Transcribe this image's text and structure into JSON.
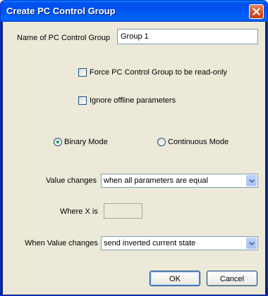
{
  "window": {
    "title": "Create PC Control Group"
  },
  "icons": {
    "close": "close-icon",
    "dropdown": "chevron-down-icon"
  },
  "form": {
    "name_label": "Name of PC Control Group",
    "name_value": "Group 1",
    "force_readonly_label": "Force PC Control Group to be read-only",
    "force_readonly_checked": false,
    "ignore_offline_label": "Ignore offline parameters",
    "ignore_offline_checked": false,
    "mode_binary_label": "Binary Mode",
    "mode_continuous_label": "Continuous Mode",
    "mode_selected": "Binary Mode",
    "value_changes_label": "Value changes",
    "value_changes_selected": "when all parameters are equal",
    "where_x_label": "Where X is",
    "where_x_value": "",
    "when_value_changes_label": "When Value changes",
    "when_value_changes_selected": "send inverted current state"
  },
  "buttons": {
    "ok": "OK",
    "cancel": "Cancel"
  },
  "colors": {
    "titlebar": "#0054e3",
    "dialog_background": "#ece9d8",
    "close_button": "#d85a2d",
    "radio_dot": "#21a121",
    "field_border": "#7f9db9"
  }
}
